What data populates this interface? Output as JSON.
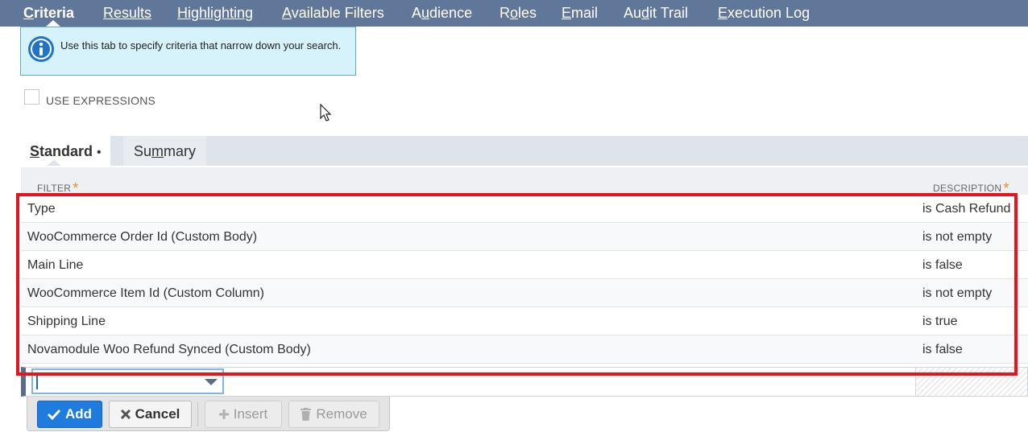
{
  "top_tabs": [
    {
      "pre": "",
      "u": "C",
      "post": "riteria"
    },
    {
      "pre": "",
      "u": "R",
      "post": "esults"
    },
    {
      "pre": "",
      "u": "H",
      "post": "ighlighting"
    },
    {
      "pre": "",
      "u": "A",
      "post": "vailable Filters"
    },
    {
      "pre": "A",
      "u": "u",
      "post": "dience"
    },
    {
      "pre": "R",
      "u": "o",
      "post": "les"
    },
    {
      "pre": "",
      "u": "E",
      "post": "mail"
    },
    {
      "pre": "Au",
      "u": "d",
      "post": "it Trail"
    },
    {
      "pre": "",
      "u": "E",
      "post": "xecution Log"
    }
  ],
  "info": {
    "text": "Use this tab to specify criteria that narrow down your search.",
    "icon": "info-icon"
  },
  "use_expressions_label": "USE EXPRESSIONS",
  "sub_tabs": {
    "standard": {
      "u": "S",
      "post": "tandard",
      "dot": "•"
    },
    "summary": {
      "pre": "Su",
      "u": "m",
      "post": "mary"
    }
  },
  "table": {
    "headers": {
      "filter": "FILTER",
      "description": "DESCRIPTION",
      "required_mark": "*"
    },
    "rows": [
      {
        "filter": "Type",
        "description": "is Cash Refund"
      },
      {
        "filter": "WooCommerce Order Id (Custom Body)",
        "description": "is not empty"
      },
      {
        "filter": "Main Line",
        "description": "is false"
      },
      {
        "filter": "WooCommerce Item Id (Custom Column)",
        "description": "is not empty"
      },
      {
        "filter": "Shipping Line",
        "description": "is true"
      },
      {
        "filter": "Novamodule Woo Refund Synced (Custom Body)",
        "description": "is false"
      }
    ]
  },
  "buttons": {
    "add": "Add",
    "cancel": "Cancel",
    "insert": "Insert",
    "remove": "Remove"
  },
  "colors": {
    "topbar": "#607799",
    "highlight": "#e8141c",
    "primary": "#1f7bdc"
  }
}
